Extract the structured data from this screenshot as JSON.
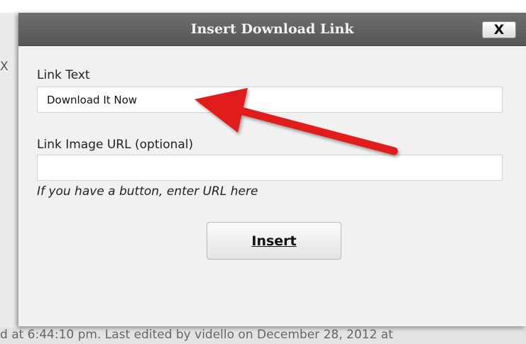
{
  "background": {
    "left_fragment": "X",
    "bottom_text": "d at 6:44:10 pm. Last edited by vidello on December 28, 2012 at"
  },
  "dialog": {
    "title": "Insert Download Link",
    "close_label": "X",
    "link_text": {
      "label": "Link Text",
      "value": "Download It Now"
    },
    "link_image": {
      "label": "Link Image URL (optional)",
      "value": "",
      "hint": "If you have a button, enter URL here"
    },
    "insert_label": "Insert"
  },
  "colors": {
    "titlebar": "#606060",
    "dialog_bg": "#f1f1f1",
    "arrow": "#e01a1a"
  },
  "icons": {
    "annotation": "red-arrow"
  }
}
